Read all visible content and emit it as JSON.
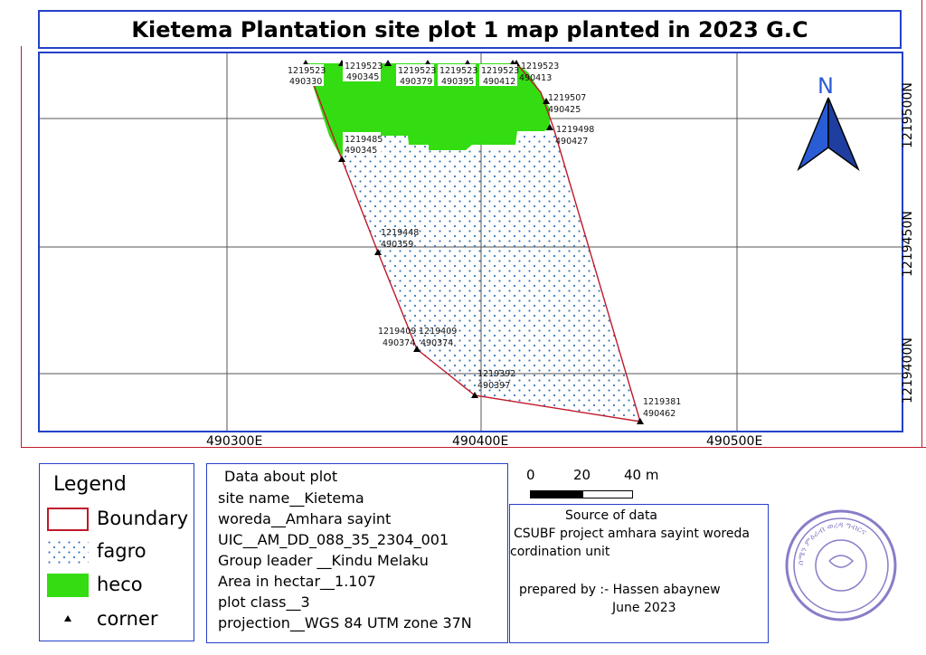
{
  "title": "Kietema Plantation site plot 1 map planted in 2023 G.C",
  "grid": {
    "easting_labels": [
      "490300E",
      "490400E",
      "490500E"
    ],
    "northing_labels": [
      "1219500N",
      "1219450N",
      "1219400N"
    ]
  },
  "north_arrow": {
    "letter": "N",
    "color": "#2a5cd6"
  },
  "colors": {
    "boundary": "#c0192c",
    "heco": "#33dd11",
    "fagro_dot": "#3a78b8",
    "frame": "#2440c8"
  },
  "points": [
    {
      "n": "1219523",
      "e": "490330"
    },
    {
      "n": "1219523",
      "e": "490345"
    },
    {
      "n": "1219523",
      "e": "490379"
    },
    {
      "n": "1219523",
      "e": "490395"
    },
    {
      "n": "1219523",
      "e": "490412"
    },
    {
      "n": "1219523",
      "e": "490413"
    },
    {
      "n": "1219507",
      "e": "490425"
    },
    {
      "n": "1219498",
      "e": "490427"
    },
    {
      "n": "1219485",
      "e": "490345"
    },
    {
      "n": "1219448",
      "e": "490359"
    },
    {
      "n": "1219409",
      "e": "490374"
    },
    {
      "n": "1219409",
      "e": "490374"
    },
    {
      "n": "1219392",
      "e": "490397"
    },
    {
      "n": "1219381",
      "e": "490462"
    }
  ],
  "legend": {
    "title": "Legend",
    "items": [
      {
        "label": "Boundary",
        "type": "boundary"
      },
      {
        "label": "fagro",
        "type": "fagro"
      },
      {
        "label": "heco",
        "type": "heco"
      },
      {
        "label": "corner",
        "type": "corner"
      }
    ]
  },
  "plot_info": {
    "heading": "Data about plot",
    "site": "site name__Kietema",
    "woreda": "woreda__Amhara sayint",
    "uic": "UIC__AM_DD_088_35_2304_001",
    "leader": "Group leader __Kindu Melaku",
    "area": "Area in hectar__1.107",
    "class": "plot class__3",
    "projection": "projection__WGS 84 UTM zone 37N"
  },
  "scale": {
    "t0": "0",
    "t20": "20",
    "t40": "40 m"
  },
  "source": {
    "heading": "Source of data",
    "line1": "CSUBF project amhara sayint woreda",
    "line2": "cordination unit",
    "prepared": "prepared by :- Hassen abaynew",
    "date": "June 2023"
  },
  "stamp": {
    "text": "ሰሜን ምዕራብ ወረዳ ግብርና"
  }
}
